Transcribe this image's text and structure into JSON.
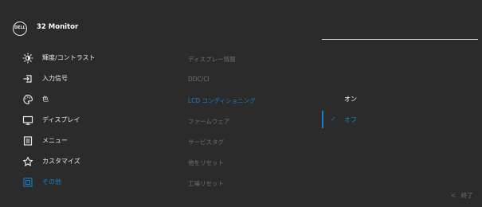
{
  "header": {
    "logo_text": "DELL",
    "model": "32 Monitor"
  },
  "menu": {
    "items": [
      {
        "label": "輝度/コントラスト",
        "icon": "brightness-icon"
      },
      {
        "label": "入力信号",
        "icon": "input-source-icon"
      },
      {
        "label": "色",
        "icon": "color-palette-icon"
      },
      {
        "label": "ディスプレイ",
        "icon": "display-icon"
      },
      {
        "label": "メニュー",
        "icon": "menu-icon"
      },
      {
        "label": "カスタマイズ",
        "icon": "star-icon"
      },
      {
        "label": "その他",
        "icon": "others-icon"
      }
    ],
    "active_index": 6
  },
  "submenu": {
    "items": [
      "ディスプレー情報",
      "DDC/CI",
      "LCD コンディショニング",
      "ファームウェア",
      "サービスタグ",
      "他をリセット",
      "工場リセット"
    ],
    "active_index": 2
  },
  "options": {
    "on_label": "オン",
    "off_label": "オフ",
    "selected": "オフ",
    "check_icon": "✓"
  },
  "footer": {
    "exit_label": "終了",
    "back_icon": "<"
  },
  "colors": {
    "background": "#2b2b2b",
    "accent": "#1a7fc4",
    "text": "#e9e9e9",
    "dim_text": "#707070"
  }
}
